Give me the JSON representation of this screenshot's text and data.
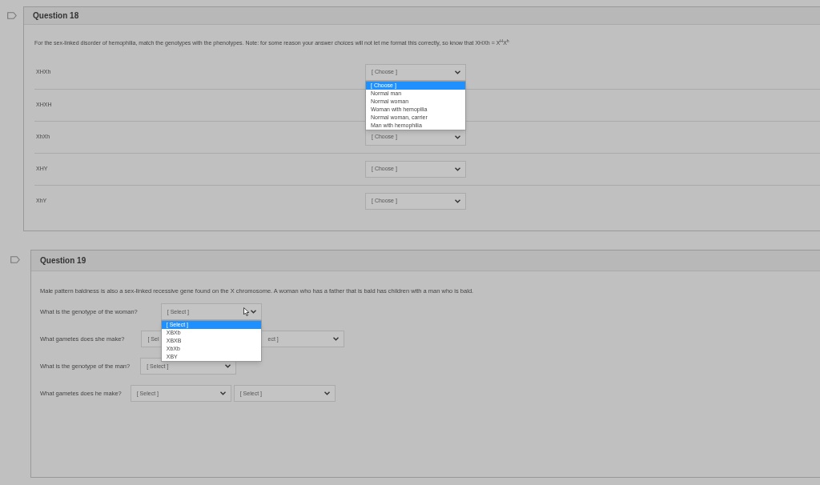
{
  "questions": [
    {
      "title": "Question 18",
      "prompt": "For the sex-linked disorder of hemophilia, match the genotypes with the phenotypes. Note: for some reason your answer choices will not let me format this correctly, so know that XHXh = X$^{H}$X$^{h}$",
      "kind": "matching",
      "rows": [
        {
          "label": "XHXh",
          "value": "[ Choose ]",
          "menu": [
            {
              "label": "[ Choose ]",
              "selected": true
            },
            {
              "label": "Normal man",
              "selected": false
            },
            {
              "label": "Normal woman",
              "selected": false
            },
            {
              "label": "Woman with hemopilia",
              "selected": false
            },
            {
              "label": "Normal woman, carrier",
              "selected": false
            },
            {
              "label": "Man with hemophilia",
              "selected": false
            }
          ]
        },
        {
          "label": "XHXH"
        },
        {
          "label": "XhXh",
          "value": "[ Choose ]"
        },
        {
          "label": "XHY",
          "value": "[ Choose ]"
        },
        {
          "label": "XhY",
          "value": "[ Choose ]"
        }
      ]
    },
    {
      "title": "Question 19",
      "prompt": "Male pattern baldness is also a sex-linked recessive gene found on the X chromosome. A woman who has a father that is bald has children with a man who is bald.",
      "kind": "inline",
      "rows": [
        {
          "label": "What is the genotype of the woman?",
          "selects": [
            {
              "value": "[ Select ]",
              "menu": [
                {
                  "label": "[ Select ]",
                  "selected": true
                },
                {
                  "label": "XBXb",
                  "selected": false
                },
                {
                  "label": "XBXB",
                  "selected": false
                },
                {
                  "label": "XbXb",
                  "selected": false
                },
                {
                  "label": "XBY",
                  "selected": false
                }
              ]
            }
          ]
        },
        {
          "label": "What gametes does she make?",
          "selects": [
            {
              "value": "[ Sel"
            },
            {
              "value": "ect ]"
            }
          ]
        },
        {
          "label": "What is the genotype of the man?",
          "selects": [
            {
              "value": "[ Select ]"
            }
          ]
        },
        {
          "label": "What gametes does he make?",
          "selects": [
            {
              "value": "[ Select ]"
            },
            {
              "value": "[ Select ]"
            }
          ]
        }
      ]
    }
  ]
}
